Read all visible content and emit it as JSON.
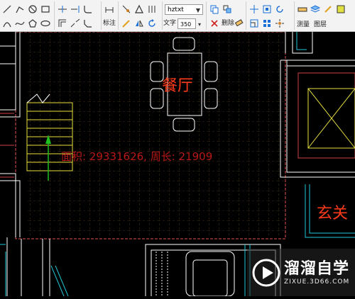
{
  "toolbar": {
    "font_name": "hztxt",
    "text_height": "350",
    "dimension_label": "标注",
    "text_label": "文字",
    "delete_label": "删除",
    "measure_label": "测量",
    "layer_label": "图层"
  },
  "drawing": {
    "room_dining": "餐厅",
    "room_foyer": "玄关",
    "area_text": "面积: 29331626, 周长: 21909"
  },
  "watermark": {
    "title": "溜溜自学",
    "url": "ZIXUE.3D66.COM"
  },
  "colors": {
    "background": "#000000",
    "room_label": "#ff3a1a",
    "area_text": "#b81818",
    "wall": "#ffffff",
    "furniture": "#ffffff",
    "stairs": "#e8e040",
    "window": "#20c8d8",
    "grid": "#8a6a2a",
    "boundary": "#e05050"
  }
}
